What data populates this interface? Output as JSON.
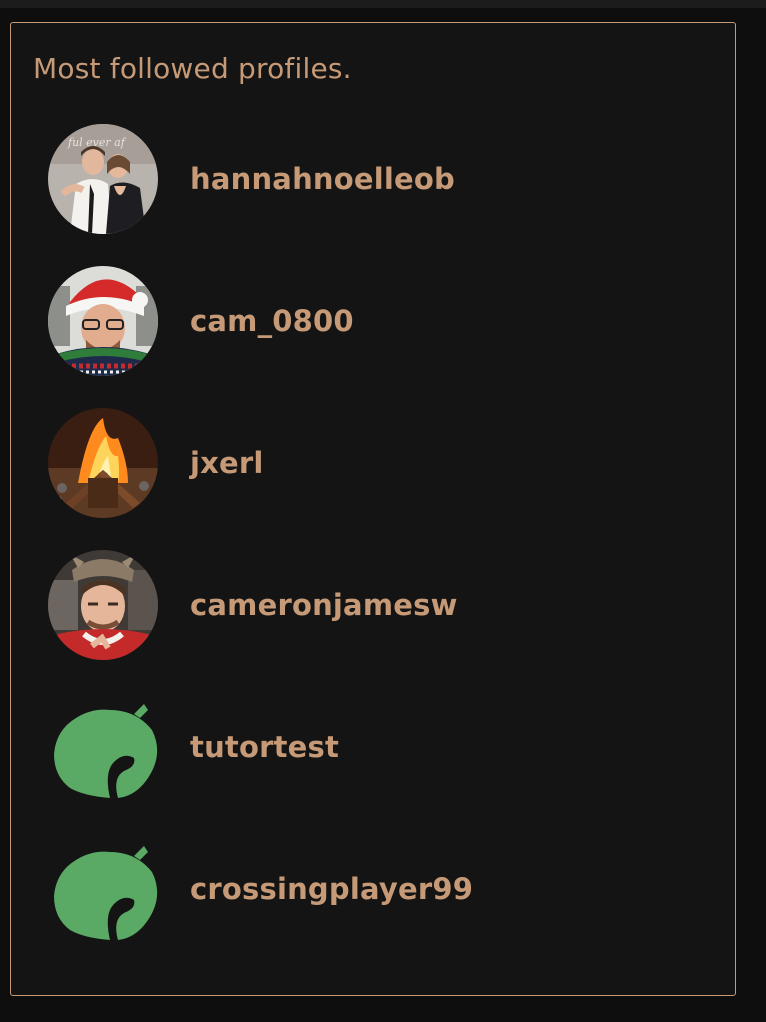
{
  "panel": {
    "title": "Most followed profiles.",
    "accent_color": "#c69a76",
    "background_color": "#141414"
  },
  "profiles": [
    {
      "username": "hannahnoelleob",
      "avatar": "photo-couple"
    },
    {
      "username": "cam_0800",
      "avatar": "photo-santa-hat"
    },
    {
      "username": "jxerl",
      "avatar": "photo-bonfire"
    },
    {
      "username": "cameronjamesw",
      "avatar": "photo-selfie"
    },
    {
      "username": "tutortest",
      "avatar": "leaf-icon"
    },
    {
      "username": "crossingplayer99",
      "avatar": "leaf-icon"
    }
  ],
  "leaf_color": "#5aa965"
}
